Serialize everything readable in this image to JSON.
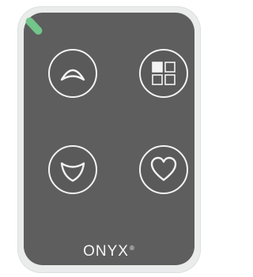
{
  "device": {
    "brand_name": "ONYX",
    "brand_mark": "®",
    "colors": {
      "shell": "#e9ecea",
      "face": "#5d5e5d",
      "button_stroke": "#f3f3f3",
      "led": "#72c58b"
    },
    "buttons": [
      {
        "id": "up",
        "icon": "chevron-up-icon"
      },
      {
        "id": "menu",
        "icon": "grid-icon"
      },
      {
        "id": "down",
        "icon": "chevron-down-icon"
      },
      {
        "id": "favorite",
        "icon": "heart-icon"
      }
    ]
  }
}
